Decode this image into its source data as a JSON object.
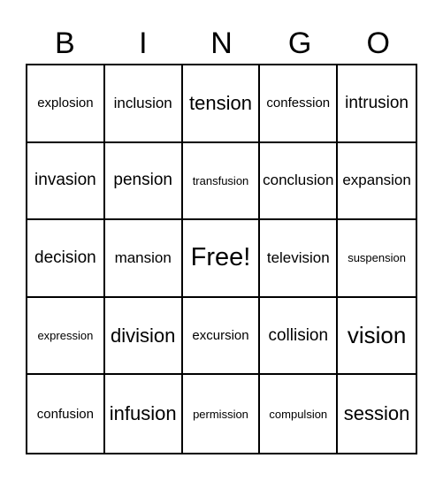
{
  "header": {
    "letters": [
      "B",
      "I",
      "N",
      "G",
      "O"
    ]
  },
  "board": {
    "rows": [
      [
        "explosion",
        "inclusion",
        "tension",
        "confession",
        "intrusion"
      ],
      [
        "invasion",
        "pension",
        "transfusion",
        "conclusion",
        "expansion"
      ],
      [
        "decision",
        "mansion",
        "Free!",
        "television",
        "suspension"
      ],
      [
        "expression",
        "division",
        "excursion",
        "collision",
        "vision"
      ],
      [
        "confusion",
        "infusion",
        "permission",
        "compulsion",
        "session"
      ]
    ]
  }
}
